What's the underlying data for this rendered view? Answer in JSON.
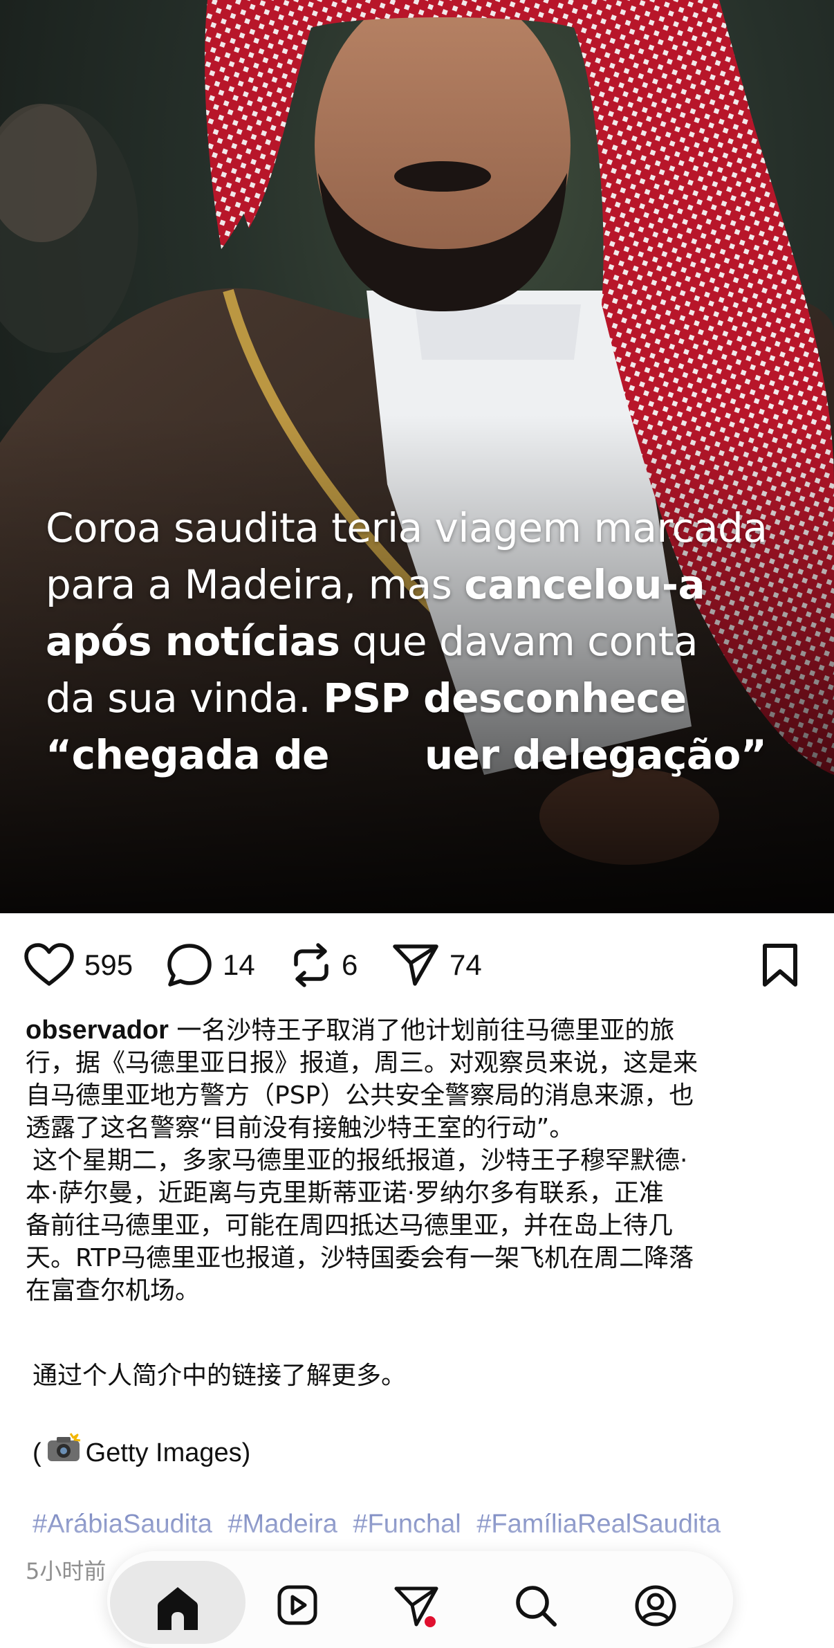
{
  "post": {
    "media": {
      "overlay_lines": [
        [
          {
            "t": "Coroa saudita teria viagem marcada",
            "b": false
          }
        ],
        [
          {
            "t": "para a Madeira, mas ",
            "b": false
          },
          {
            "t": "cancelou-a",
            "b": true
          }
        ],
        [
          {
            "t": "após notícias",
            "b": true
          },
          {
            "t": " que davam conta",
            "b": false
          }
        ],
        [
          {
            "t": "da sua vinda. ",
            "b": false
          },
          {
            "t": "PSP desconhece",
            "b": true
          }
        ],
        [
          {
            "t": "“chegada de ",
            "b": true
          },
          {
            "t": "      ",
            "b": true
          },
          {
            "t": "uer delegação”",
            "b": true
          }
        ]
      ]
    },
    "actions": {
      "likes": "595",
      "comments": "14",
      "reposts": "6",
      "shares": "74"
    },
    "caption": {
      "username": "observador",
      "paragraph1_lines": [
        " 一名沙特王子取消了他计划前往马德里亚的旅",
        "行，据《马德里亚日报》报道，周三。对观察员来说，这是来",
        "自马德里亚地方警方（PSP）公共安全警察局的消息来源，也",
        "透露了这名警察“目前没有接触沙特王室的行动”。"
      ],
      "paragraph2_lines": [
        "这个星期二，多家马德里亚的报纸报道，沙特王子穆罕默德·",
        "本·萨尔曼，近距离与克里斯蒂亚诺·罗纳尔多有联系，正准",
        "备前往马德里亚，可能在周四抵达马德里亚，并在岛上待几",
        "天。RTP马德里亚也报道，沙特国委会有一架飞机在周二降落",
        "在富查尔机场。"
      ],
      "cta": "通过个人简介中的链接了解更多。",
      "credit_open": "(",
      "credit_text": " Getty Images)",
      "hashtags": [
        "#ArábiaSaudita",
        "#Madeira",
        "#Funchal",
        "#FamíliaRealSaudita"
      ],
      "timestamp": "5小时前"
    }
  },
  "icons": {
    "like": "heart-outline-icon",
    "comment": "speech-bubble-icon",
    "repost": "repost-arrows-icon",
    "share": "paper-plane-icon",
    "save": "bookmark-icon",
    "credit": "camera-flash-emoji",
    "nav": [
      "home-icon",
      "reels-icon",
      "direct-messages-icon",
      "search-icon",
      "profile-icon"
    ]
  },
  "colors": {
    "hashtag": "#3a4fa3",
    "timestamp": "#8e8e8e",
    "notification_dot": "#e0102f"
  }
}
